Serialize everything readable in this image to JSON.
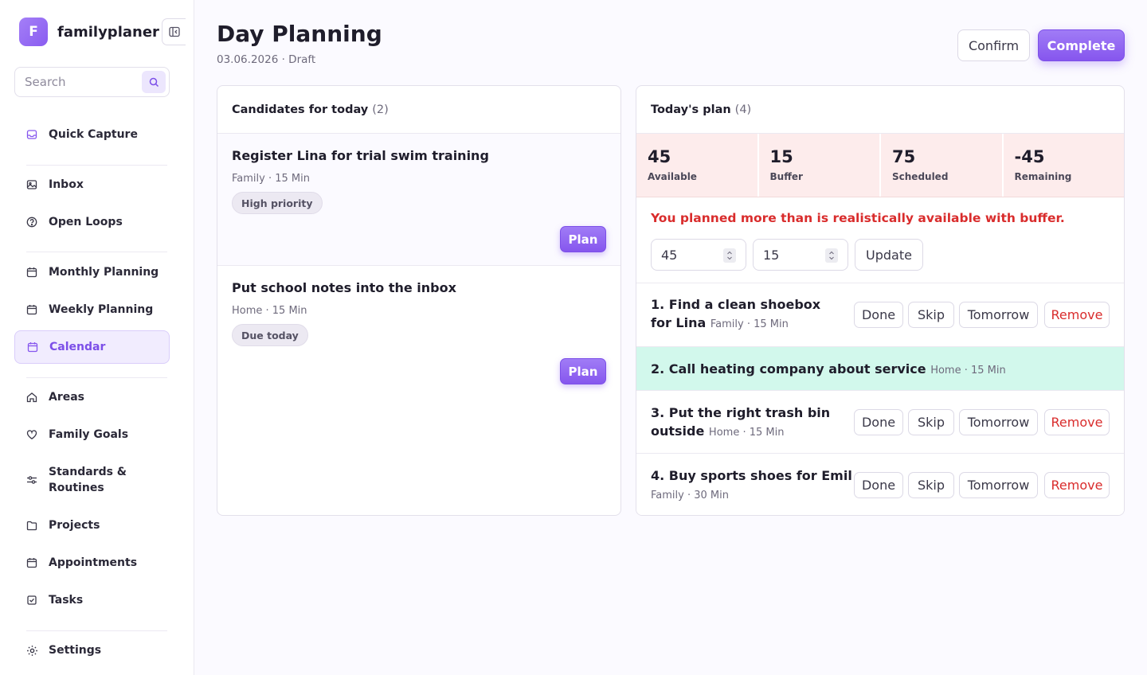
{
  "app": {
    "logo_letter": "F",
    "name": "familyplaner"
  },
  "search": {
    "placeholder": "Search"
  },
  "sidebar": {
    "items": [
      {
        "label": "Quick Capture",
        "icon": "inbox-tray-icon"
      },
      {
        "label": "Inbox",
        "icon": "image-icon"
      },
      {
        "label": "Open Loops",
        "icon": "help-circle-icon"
      },
      {
        "label": "Monthly Planning",
        "icon": "calendar-icon"
      },
      {
        "label": "Weekly Planning",
        "icon": "calendar-icon"
      },
      {
        "label": "Calendar",
        "icon": "calendar-icon",
        "active": true
      },
      {
        "label": "Areas",
        "icon": "home-icon"
      },
      {
        "label": "Family Goals",
        "icon": "heart-icon"
      },
      {
        "label": "Standards & Routines",
        "icon": "sliders-icon"
      },
      {
        "label": "Projects",
        "icon": "folder-icon"
      },
      {
        "label": "Appointments",
        "icon": "calendar-icon"
      },
      {
        "label": "Tasks",
        "icon": "checkbox-icon"
      },
      {
        "label": "Settings",
        "icon": "gear-icon"
      }
    ]
  },
  "header": {
    "title": "Day Planning",
    "subtitle": "03.06.2026 · Draft",
    "confirm_label": "Confirm",
    "complete_label": "Complete"
  },
  "candidates": {
    "title": "Candidates for today",
    "count": "(2)",
    "items": [
      {
        "title": "Register Lina for trial swim training",
        "meta": "Family · 15 Min",
        "badge": "High priority",
        "action": "Plan"
      },
      {
        "title": "Put school notes into the inbox",
        "meta": "Home · 15 Min",
        "badge": "Due today",
        "action": "Plan"
      }
    ]
  },
  "plan": {
    "title": "Today's plan",
    "count": "(4)",
    "stats": [
      {
        "value": "45",
        "label": "Available"
      },
      {
        "value": "15",
        "label": "Buffer"
      },
      {
        "value": "75",
        "label": "Scheduled"
      },
      {
        "value": "-45",
        "label": "Remaining"
      }
    ],
    "warning": "You planned more than is realistically available with buffer.",
    "available_input": "45",
    "buffer_input": "15",
    "update_label": "Update",
    "actions": {
      "done": "Done",
      "skip": "Skip",
      "tomorrow": "Tomorrow",
      "remove": "Remove"
    },
    "items": [
      {
        "title": "1. Find a clean shoebox for Lina",
        "meta": "Family · 15 Min"
      },
      {
        "title": "2. Call heating company about service",
        "meta": "Home · 15 Min",
        "highlight": true
      },
      {
        "title": "3. Put the right trash bin outside",
        "meta": "Home · 15 Min"
      },
      {
        "title": "4. Buy sports shoes for Emil",
        "meta": "Family · 30 Min"
      }
    ]
  },
  "colors": {
    "accent": "#8656ee",
    "danger": "#d92c2c",
    "highlight": "#d2f8ec",
    "stat_bg": "#fdecec"
  }
}
